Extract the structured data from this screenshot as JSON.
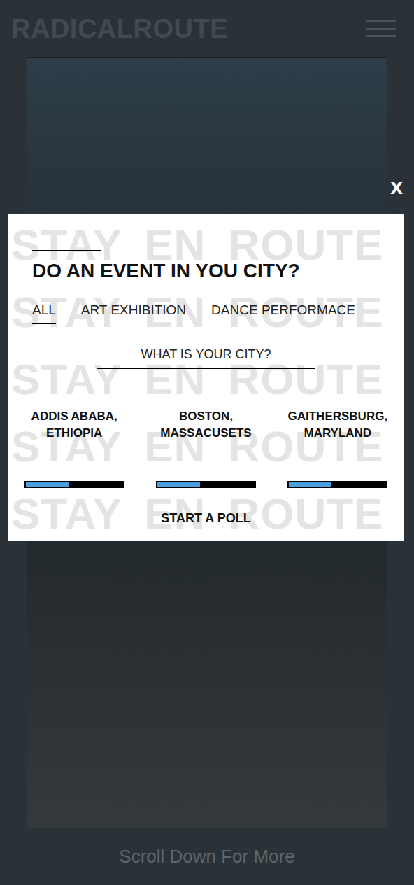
{
  "logo": "RADICALROUTE",
  "close": "x",
  "modal": {
    "watermark": [
      "STAY EN ROUTE",
      "STAY EN ROUTE",
      "STAY EN ROUTE",
      "STAY EN ROUTE",
      "STAY EN ROUTE"
    ],
    "heading": "DO AN EVENT IN YOU CITY?",
    "tabs": [
      {
        "label": "ALL",
        "selected": true
      },
      {
        "label": "ART EXHIBITION",
        "selected": false
      },
      {
        "label": "DANCE PERFORMACE",
        "selected": false
      }
    ],
    "question": "WHAT IS YOUR CITY?",
    "cities": [
      {
        "city": "ADDIS ABABA,",
        "region": "ETHIOPIA",
        "level": 0.44
      },
      {
        "city": "BOSTON,",
        "region": "MASSACUSETS",
        "level": 0.44
      },
      {
        "city": "GAITHERSBURG,",
        "region": "MARYLAND",
        "level": 0.44
      }
    ],
    "button": "START A POLL"
  },
  "footer": "Scroll Down For More"
}
